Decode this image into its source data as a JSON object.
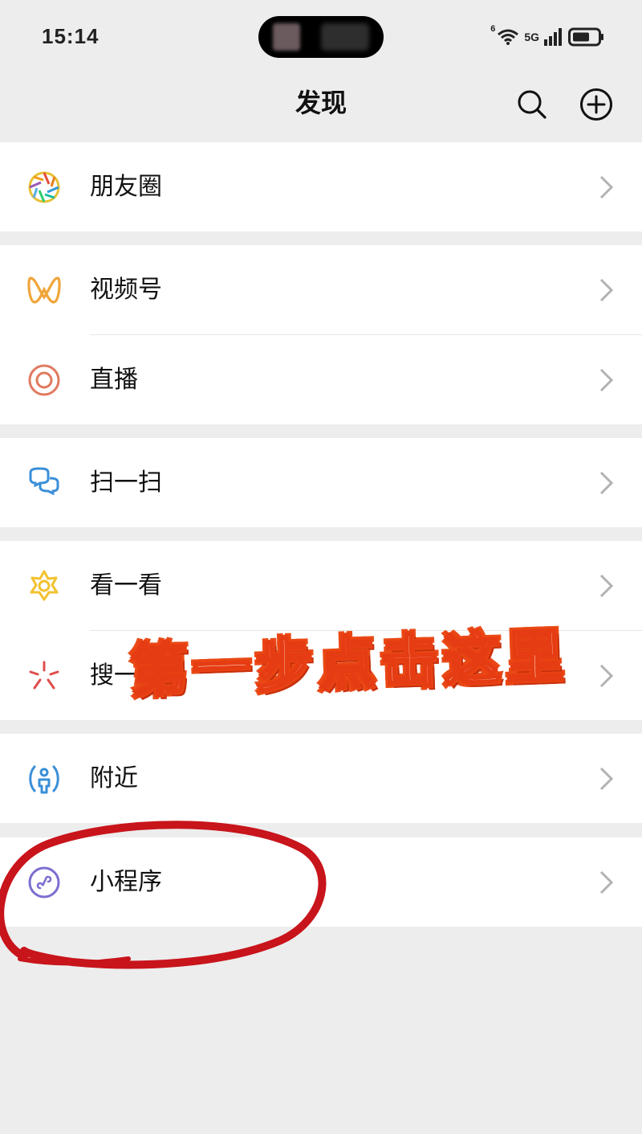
{
  "status_bar": {
    "time": "15:14",
    "network_label": "5G",
    "wifi_label": "6"
  },
  "header": {
    "title": "发现"
  },
  "menu": {
    "moments": "朋友圈",
    "channels": "视频号",
    "live": "直播",
    "scan": "扫一扫",
    "top_stories": "看一看",
    "search": "搜一搜",
    "nearby": "附近",
    "mini_programs": "小程序"
  },
  "annotation": {
    "text": "第一步点击这里"
  },
  "colors": {
    "background": "#ededed",
    "row_background": "#ffffff",
    "annotation_orange": "#e63c13",
    "circle_red": "#c8141b"
  }
}
